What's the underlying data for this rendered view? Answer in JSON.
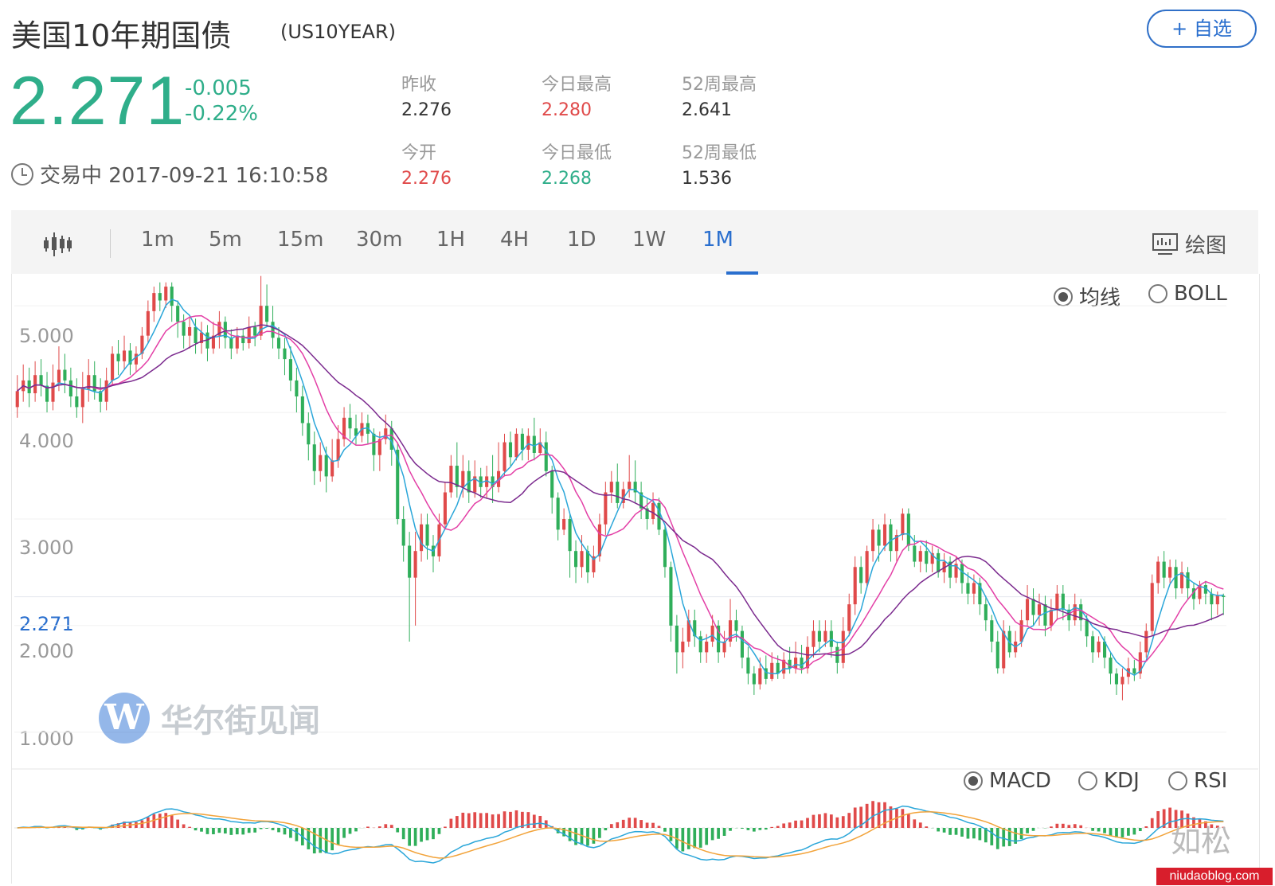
{
  "header": {
    "title": "美国10年期国债",
    "code": "(US10YEAR)",
    "follow_label": "+ 自选",
    "price": "2.271",
    "change": "-0.005",
    "change_pct": "-0.22%",
    "status": "交易中 2017-09-21 16:10:58"
  },
  "stats": {
    "prev_close_label": "昨收",
    "prev_close": "2.276",
    "open_label": "今开",
    "open": "2.276",
    "high_label": "今日最高",
    "high": "2.280",
    "low_label": "今日最低",
    "low": "2.268",
    "wk52_high_label": "52周最高",
    "wk52_high": "2.641",
    "wk52_low_label": "52周最低",
    "wk52_low": "1.536"
  },
  "toolbar": {
    "tabs": [
      "1m",
      "5m",
      "15m",
      "30m",
      "1H",
      "4H",
      "1D",
      "1W",
      "1M"
    ],
    "active_tab": "1M",
    "draw_label": "绘图"
  },
  "overlay_options": {
    "ma_label": "均线",
    "boll_label": "BOLL",
    "selected": "均线"
  },
  "indicator_options": {
    "macd_label": "MACD",
    "kdj_label": "KDJ",
    "rsi_label": "RSI",
    "selected": "MACD"
  },
  "watermarks": {
    "brand": "华尔街见闻",
    "brand_logo": "W",
    "wechat": "如松",
    "site": "niudaoblog.com"
  },
  "colors": {
    "up": "#e04a4a",
    "down": "#2fae5a",
    "accent": "#2a6fce",
    "price": "#2fae8a",
    "ma5": "#2aa6d9",
    "ma10": "#e33fa6",
    "ma20": "#7b2a8e",
    "dif": "#2aa6d9",
    "dea": "#f2a33a"
  },
  "chart_data": {
    "type": "candlestick",
    "ylim": [
      0.7,
      5.3
    ],
    "yticks": [
      1.0,
      2.0,
      3.0,
      4.0,
      5.0
    ],
    "ytick_labels": [
      "1.000",
      "2.000",
      "3.000",
      "4.000",
      "5.000"
    ],
    "current_price": 2.271,
    "current_price_label": "2.271",
    "candles": [
      [
        4.05,
        4.2,
        4.35,
        3.95
      ],
      [
        4.2,
        4.3,
        4.45,
        4.1
      ],
      [
        4.3,
        4.18,
        4.42,
        4.05
      ],
      [
        4.18,
        4.35,
        4.48,
        4.1
      ],
      [
        4.35,
        4.25,
        4.5,
        4.15
      ],
      [
        4.25,
        4.1,
        4.38,
        4.0
      ],
      [
        4.1,
        4.28,
        4.45,
        4.02
      ],
      [
        4.28,
        4.4,
        4.62,
        4.2
      ],
      [
        4.4,
        4.3,
        4.55,
        4.18
      ],
      [
        4.3,
        4.15,
        4.42,
        4.05
      ],
      [
        4.15,
        4.05,
        4.32,
        3.95
      ],
      [
        4.05,
        4.22,
        4.38,
        3.9
      ],
      [
        4.22,
        4.35,
        4.5,
        4.1
      ],
      [
        4.35,
        4.2,
        4.48,
        4.12
      ],
      [
        4.2,
        4.1,
        4.32,
        4.0
      ],
      [
        4.1,
        4.3,
        4.42,
        4.02
      ],
      [
        4.3,
        4.55,
        4.62,
        4.25
      ],
      [
        4.55,
        4.48,
        4.68,
        4.35
      ],
      [
        4.48,
        4.58,
        4.72,
        4.4
      ],
      [
        4.58,
        4.45,
        4.65,
        4.35
      ],
      [
        4.45,
        4.55,
        4.62,
        4.38
      ],
      [
        4.55,
        4.72,
        4.8,
        4.5
      ],
      [
        4.72,
        4.95,
        5.05,
        4.65
      ],
      [
        4.95,
        5.12,
        5.18,
        4.85
      ],
      [
        5.12,
        5.05,
        5.22,
        4.95
      ],
      [
        5.05,
        5.18,
        5.22,
        4.98
      ],
      [
        5.18,
        5.0,
        5.22,
        4.85
      ],
      [
        5.0,
        4.85,
        5.05,
        4.7
      ],
      [
        4.85,
        4.72,
        4.92,
        4.6
      ],
      [
        4.72,
        4.8,
        4.9,
        4.6
      ],
      [
        4.8,
        4.65,
        4.88,
        4.55
      ],
      [
        4.65,
        4.75,
        4.85,
        4.55
      ],
      [
        4.75,
        4.6,
        4.82,
        4.48
      ],
      [
        4.6,
        4.72,
        4.85,
        4.55
      ],
      [
        4.72,
        4.85,
        4.95,
        4.6
      ],
      [
        4.85,
        4.7,
        4.9,
        4.6
      ],
      [
        4.7,
        4.6,
        4.78,
        4.5
      ],
      [
        4.6,
        4.72,
        4.8,
        4.55
      ],
      [
        4.72,
        4.65,
        4.78,
        4.58
      ],
      [
        4.65,
        4.8,
        4.9,
        4.6
      ],
      [
        4.8,
        4.72,
        4.85,
        4.62
      ],
      [
        4.72,
        5.0,
        5.28,
        4.68
      ],
      [
        5.0,
        4.85,
        5.2,
        4.8
      ],
      [
        4.85,
        4.7,
        5.0,
        4.6
      ],
      [
        4.7,
        4.6,
        4.8,
        4.5
      ],
      [
        4.6,
        4.5,
        4.7,
        4.35
      ],
      [
        4.5,
        4.3,
        4.62,
        4.2
      ],
      [
        4.3,
        4.15,
        4.42,
        4.0
      ],
      [
        4.15,
        3.9,
        4.25,
        3.78
      ],
      [
        3.9,
        3.7,
        4.0,
        3.55
      ],
      [
        3.7,
        3.45,
        3.82,
        3.32
      ],
      [
        3.45,
        3.6,
        3.72,
        3.35
      ],
      [
        3.6,
        3.4,
        3.68,
        3.25
      ],
      [
        3.4,
        3.55,
        3.75,
        3.35
      ],
      [
        3.55,
        3.75,
        3.88,
        3.48
      ],
      [
        3.75,
        3.95,
        4.05,
        3.68
      ],
      [
        3.95,
        3.85,
        4.08,
        3.75
      ],
      [
        3.85,
        3.78,
        3.98,
        3.7
      ],
      [
        3.78,
        3.9,
        4.0,
        3.72
      ],
      [
        3.9,
        3.8,
        3.98,
        3.7
      ],
      [
        3.8,
        3.6,
        3.85,
        3.45
      ],
      [
        3.6,
        3.75,
        3.82,
        3.45
      ],
      [
        3.75,
        3.85,
        3.98,
        3.7
      ],
      [
        3.85,
        3.65,
        3.92,
        3.5
      ],
      [
        3.65,
        3.0,
        3.72,
        2.95
      ],
      [
        3.0,
        2.75,
        3.12,
        2.6
      ],
      [
        2.75,
        2.45,
        2.88,
        1.85
      ],
      [
        2.45,
        2.7,
        2.88,
        2.0
      ],
      [
        2.7,
        2.95,
        3.05,
        2.6
      ],
      [
        2.95,
        2.75,
        3.05,
        2.62
      ],
      [
        2.75,
        2.65,
        2.85,
        2.5
      ],
      [
        2.65,
        2.95,
        3.05,
        2.6
      ],
      [
        2.95,
        3.25,
        3.35,
        2.9
      ],
      [
        3.25,
        3.5,
        3.6,
        3.2
      ],
      [
        3.5,
        3.3,
        3.72,
        3.2
      ],
      [
        3.3,
        3.45,
        3.6,
        3.2
      ],
      [
        3.45,
        3.25,
        3.55,
        3.15
      ],
      [
        3.25,
        3.4,
        3.55,
        3.2
      ],
      [
        3.4,
        3.3,
        3.48,
        3.2
      ],
      [
        3.3,
        3.4,
        3.5,
        3.2
      ],
      [
        3.4,
        3.3,
        3.6,
        3.15
      ],
      [
        3.3,
        3.45,
        3.72,
        3.25
      ],
      [
        3.45,
        3.72,
        3.8,
        3.4
      ],
      [
        3.72,
        3.58,
        3.82,
        3.5
      ],
      [
        3.58,
        3.8,
        3.85,
        3.55
      ],
      [
        3.8,
        3.65,
        3.85,
        3.55
      ],
      [
        3.65,
        3.78,
        3.85,
        3.55
      ],
      [
        3.78,
        3.62,
        3.95,
        3.55
      ],
      [
        3.62,
        3.72,
        3.85,
        3.6
      ],
      [
        3.72,
        3.45,
        3.82,
        3.4
      ],
      [
        3.45,
        3.2,
        3.5,
        3.05
      ],
      [
        3.2,
        2.9,
        3.25,
        2.8
      ],
      [
        2.9,
        3.0,
        3.1,
        2.85
      ],
      [
        3.0,
        2.7,
        3.05,
        2.45
      ],
      [
        2.7,
        2.55,
        2.8,
        2.4
      ],
      [
        2.55,
        2.7,
        2.85,
        2.45
      ],
      [
        2.7,
        2.5,
        2.75,
        2.4
      ],
      [
        2.5,
        2.65,
        2.75,
        2.45
      ],
      [
        2.65,
        2.95,
        3.05,
        2.6
      ],
      [
        2.95,
        3.25,
        3.35,
        2.85
      ],
      [
        3.25,
        3.35,
        3.45,
        3.15
      ],
      [
        3.35,
        3.15,
        3.52,
        3.1
      ],
      [
        3.15,
        3.28,
        3.35,
        3.1
      ],
      [
        3.28,
        3.35,
        3.6,
        3.2
      ],
      [
        3.35,
        3.25,
        3.55,
        3.15
      ],
      [
        3.25,
        3.1,
        3.35,
        3.0
      ],
      [
        3.1,
        3.0,
        3.2,
        2.9
      ],
      [
        3.0,
        3.15,
        3.25,
        2.95
      ],
      [
        3.15,
        2.9,
        3.2,
        2.85
      ],
      [
        2.9,
        2.55,
        2.95,
        2.45
      ],
      [
        2.55,
        2.0,
        2.6,
        1.85
      ],
      [
        2.0,
        1.75,
        2.1,
        1.55
      ],
      [
        1.75,
        1.85,
        1.98,
        1.6
      ],
      [
        1.85,
        2.05,
        2.15,
        1.8
      ],
      [
        2.05,
        1.9,
        2.15,
        1.8
      ],
      [
        1.9,
        1.75,
        1.95,
        1.65
      ],
      [
        1.75,
        1.85,
        1.92,
        1.65
      ],
      [
        1.85,
        2.0,
        2.1,
        1.8
      ],
      [
        2.0,
        1.75,
        2.05,
        1.65
      ],
      [
        1.75,
        1.85,
        1.95,
        1.7
      ],
      [
        1.85,
        2.05,
        2.25,
        1.8
      ],
      [
        2.05,
        1.95,
        2.15,
        1.85
      ],
      [
        1.95,
        1.7,
        2.0,
        1.6
      ],
      [
        1.7,
        1.55,
        1.8,
        1.45
      ],
      [
        1.55,
        1.45,
        1.62,
        1.35
      ],
      [
        1.45,
        1.6,
        1.7,
        1.4
      ],
      [
        1.6,
        1.5,
        1.72,
        1.45
      ],
      [
        1.5,
        1.65,
        1.75,
        1.48
      ],
      [
        1.65,
        1.55,
        1.72,
        1.5
      ],
      [
        1.55,
        1.68,
        1.75,
        1.5
      ],
      [
        1.68,
        1.6,
        1.8,
        1.55
      ],
      [
        1.6,
        1.7,
        1.85,
        1.55
      ],
      [
        1.7,
        1.6,
        1.82,
        1.55
      ],
      [
        1.6,
        1.8,
        1.9,
        1.55
      ],
      [
        1.8,
        1.95,
        2.05,
        1.7
      ],
      [
        1.95,
        1.85,
        2.05,
        1.75
      ],
      [
        1.85,
        1.95,
        2.05,
        1.8
      ],
      [
        1.95,
        1.8,
        2.05,
        1.7
      ],
      [
        1.8,
        1.65,
        1.85,
        1.55
      ],
      [
        1.65,
        1.95,
        2.08,
        1.6
      ],
      [
        1.95,
        2.2,
        2.3,
        1.9
      ],
      [
        2.2,
        2.55,
        2.65,
        2.1
      ],
      [
        2.55,
        2.4,
        2.65,
        2.3
      ],
      [
        2.4,
        2.7,
        2.75,
        2.35
      ],
      [
        2.7,
        2.9,
        3.0,
        2.6
      ],
      [
        2.9,
        2.75,
        2.95,
        2.6
      ],
      [
        2.75,
        2.95,
        3.05,
        2.7
      ],
      [
        2.95,
        2.7,
        3.0,
        2.6
      ],
      [
        2.7,
        2.85,
        2.9,
        2.6
      ],
      [
        2.85,
        3.05,
        3.1,
        2.8
      ],
      [
        3.05,
        2.75,
        3.1,
        2.7
      ],
      [
        2.75,
        2.6,
        2.85,
        2.55
      ],
      [
        2.6,
        2.7,
        2.75,
        2.5
      ],
      [
        2.7,
        2.58,
        2.8,
        2.5
      ],
      [
        2.58,
        2.68,
        2.75,
        2.5
      ],
      [
        2.68,
        2.5,
        2.72,
        2.45
      ],
      [
        2.5,
        2.6,
        2.68,
        2.4
      ],
      [
        2.6,
        2.45,
        2.65,
        2.35
      ],
      [
        2.45,
        2.58,
        2.65,
        2.4
      ],
      [
        2.58,
        2.4,
        2.62,
        2.3
      ],
      [
        2.4,
        2.3,
        2.5,
        2.2
      ],
      [
        2.3,
        2.4,
        2.48,
        2.2
      ],
      [
        2.4,
        2.2,
        2.45,
        2.1
      ],
      [
        2.2,
        2.05,
        2.28,
        1.95
      ],
      [
        2.05,
        1.85,
        2.1,
        1.75
      ],
      [
        1.85,
        1.6,
        1.95,
        1.55
      ],
      [
        1.6,
        1.95,
        2.05,
        1.55
      ],
      [
        1.95,
        1.75,
        2.0,
        1.7
      ],
      [
        1.75,
        1.85,
        1.95,
        1.7
      ],
      [
        1.85,
        2.05,
        2.15,
        1.8
      ],
      [
        2.05,
        2.25,
        2.38,
        2.0
      ],
      [
        2.25,
        2.1,
        2.35,
        2.0
      ],
      [
        2.1,
        2.2,
        2.3,
        2.0
      ],
      [
        2.2,
        2.0,
        2.28,
        1.9
      ],
      [
        2.0,
        2.15,
        2.25,
        1.95
      ],
      [
        2.15,
        2.3,
        2.38,
        2.05
      ],
      [
        2.3,
        2.15,
        2.38,
        2.05
      ],
      [
        2.15,
        2.05,
        2.2,
        1.95
      ],
      [
        2.05,
        2.2,
        2.3,
        2.0
      ],
      [
        2.2,
        2.05,
        2.25,
        1.95
      ],
      [
        2.05,
        1.9,
        2.1,
        1.8
      ],
      [
        1.9,
        1.75,
        1.95,
        1.65
      ],
      [
        1.75,
        1.85,
        1.9,
        1.7
      ],
      [
        1.85,
        1.7,
        1.9,
        1.6
      ],
      [
        1.7,
        1.55,
        1.75,
        1.45
      ],
      [
        1.55,
        1.45,
        1.6,
        1.35
      ],
      [
        1.45,
        1.52,
        1.6,
        1.3
      ],
      [
        1.52,
        1.6,
        1.7,
        1.45
      ],
      [
        1.6,
        1.55,
        1.68,
        1.48
      ],
      [
        1.55,
        1.75,
        1.85,
        1.5
      ],
      [
        1.75,
        1.95,
        2.02,
        1.7
      ],
      [
        1.95,
        2.4,
        2.48,
        1.9
      ],
      [
        2.4,
        2.6,
        2.65,
        2.3
      ],
      [
        2.6,
        2.45,
        2.7,
        2.35
      ],
      [
        2.45,
        2.55,
        2.62,
        2.4
      ],
      [
        2.55,
        2.35,
        2.62,
        2.25
      ],
      [
        2.35,
        2.5,
        2.6,
        2.3
      ],
      [
        2.5,
        2.35,
        2.55,
        2.25
      ],
      [
        2.35,
        2.25,
        2.4,
        2.15
      ],
      [
        2.25,
        2.38,
        2.42,
        2.2
      ],
      [
        2.38,
        2.3,
        2.42,
        2.2
      ],
      [
        2.3,
        2.2,
        2.35,
        2.05
      ],
      [
        2.2,
        2.28,
        2.32,
        2.1
      ],
      [
        2.28,
        2.271,
        2.3,
        2.1
      ]
    ],
    "ma_series": [
      {
        "key": "ma5",
        "period": 5
      },
      {
        "key": "ma10",
        "period": 10
      },
      {
        "key": "ma20",
        "period": 20
      }
    ],
    "macd": {
      "fast": 12,
      "slow": 26,
      "signal": 9
    }
  }
}
